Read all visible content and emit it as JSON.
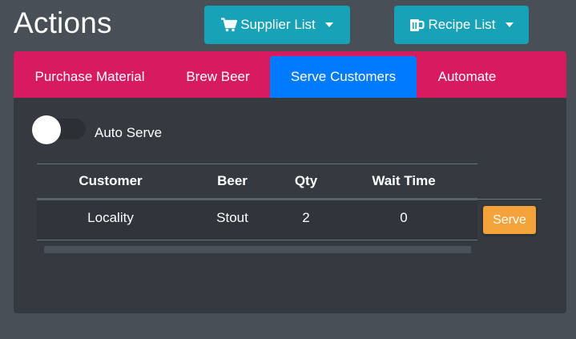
{
  "page": {
    "title": "Actions"
  },
  "buttons": {
    "supplier_list": "Supplier List",
    "recipe_list": "Recipe List"
  },
  "tabs": [
    {
      "label": "Purchase Material"
    },
    {
      "label": "Brew Beer"
    },
    {
      "label": "Serve Customers",
      "active": true
    },
    {
      "label": "Automate"
    }
  ],
  "auto_serve": {
    "label": "Auto Serve",
    "enabled": false
  },
  "table": {
    "headers": [
      "Customer",
      "Beer",
      "Qty",
      "Wait Time"
    ],
    "rows": [
      {
        "customer": "Locality",
        "beer": "Stout",
        "qty": "2",
        "wait_time": "0",
        "action": "Serve"
      }
    ]
  },
  "icons": {
    "supplier": "shopping-cart-icon",
    "recipe": "beer-mug-icon",
    "caret": "caret-down-icon"
  },
  "colors": {
    "page_bg": "#484f57",
    "info_button": "#17a2b8",
    "tab_bar": "#d81b60",
    "active_tab": "#007bff",
    "card_bg": "#343a40",
    "serve_button": "#f4a23a"
  }
}
